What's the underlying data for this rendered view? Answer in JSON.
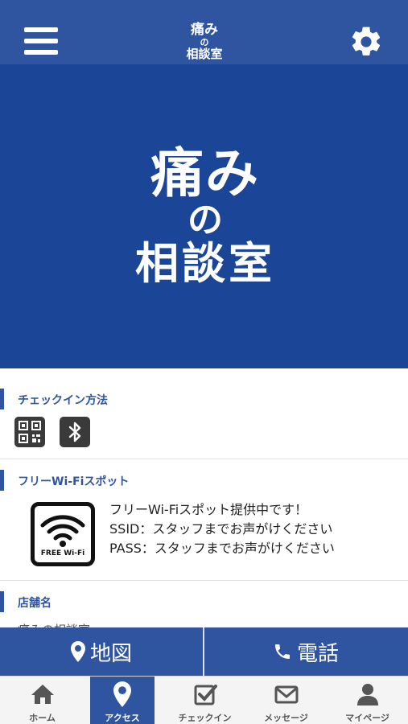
{
  "header": {
    "logo_line1": "痛み",
    "logo_line2": "の",
    "logo_line3": "相談室"
  },
  "hero": {
    "logo_line1": "痛み",
    "logo_line2": "の",
    "logo_line3": "相談室"
  },
  "checkin": {
    "title": "チェックイン方法",
    "icons": [
      "qr-code-icon",
      "bluetooth-icon"
    ]
  },
  "wifi": {
    "title": "フリーWi-Fiスポット",
    "card_caption": "FREE Wi-Fi",
    "lines": [
      "フリーWi-Fiスポット提供中です！",
      "SSID：スタッフまでお声がけください",
      "PASS：スタッフまでお声がけください"
    ]
  },
  "store": {
    "title": "店舗名",
    "name_peek": "痛みの相談室"
  },
  "actions": {
    "map_label": "地図",
    "phone_label": "電話"
  },
  "tabs": [
    {
      "label": "ホーム",
      "icon": "home-icon"
    },
    {
      "label": "アクセス",
      "icon": "map-pin-icon"
    },
    {
      "label": "チェックイン",
      "icon": "checkbox-icon"
    },
    {
      "label": "メッセージ",
      "icon": "mail-icon"
    },
    {
      "label": "マイページ",
      "icon": "person-icon"
    }
  ],
  "active_tab": "アクセス",
  "colors": {
    "brand": "#2f55a0",
    "hero": "#1b4596"
  }
}
